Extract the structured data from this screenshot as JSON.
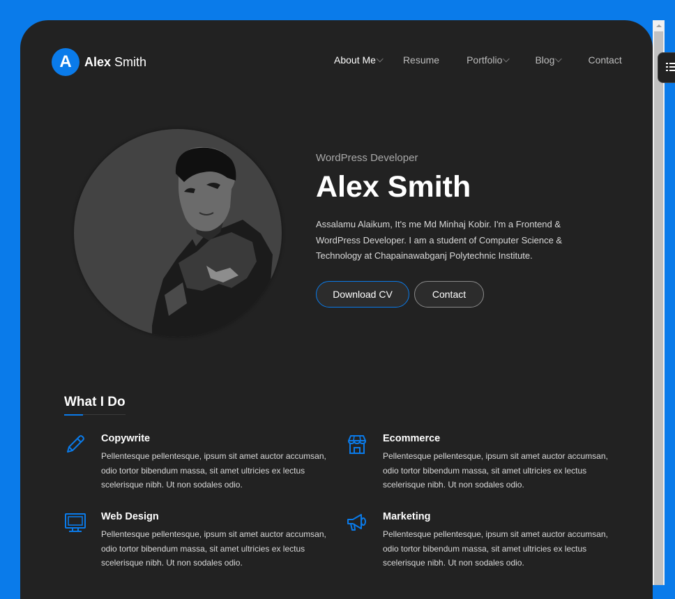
{
  "brand": {
    "badge": "A",
    "first": "Alex",
    "last": " Smith"
  },
  "nav": [
    {
      "label": "About Me",
      "dropdown": true,
      "active": true
    },
    {
      "label": "Resume",
      "dropdown": false,
      "active": false
    },
    {
      "label": "Portfolio",
      "dropdown": true,
      "active": false
    },
    {
      "label": "Blog",
      "dropdown": true,
      "active": false
    },
    {
      "label": "Contact",
      "dropdown": false,
      "active": false
    }
  ],
  "hero": {
    "subtitle": "WordPress Developer",
    "name": "Alex Smith",
    "bio": "Assalamu Alaikum, It's me Md Minhaj Kobir. I'm a Frontend & WordPress Developer. I am a student of Computer Science & Technology at Chapainawabganj Polytechnic Institute.",
    "download_cv": "Download CV",
    "contact": "Contact"
  },
  "services": {
    "title": "What I Do",
    "items": [
      {
        "title": "Copywrite",
        "icon": "pencil-icon",
        "text": "Pellentesque pellentesque, ipsum sit amet auctor accumsan, odio tortor bibendum massa, sit amet ultricies ex lectus scelerisque nibh. Ut non sodales odio."
      },
      {
        "title": "Ecommerce",
        "icon": "store-icon",
        "text": "Pellentesque pellentesque, ipsum sit amet auctor accumsan, odio tortor bibendum massa, sit amet ultricies ex lectus scelerisque nibh. Ut non sodales odio."
      },
      {
        "title": "Web Design",
        "icon": "monitor-icon",
        "text": "Pellentesque pellentesque, ipsum sit amet auctor accumsan, odio tortor bibendum massa, sit amet ultricies ex lectus scelerisque nibh. Ut non sodales odio."
      },
      {
        "title": "Marketing",
        "icon": "megaphone-icon",
        "text": "Pellentesque pellentesque, ipsum sit amet auctor accumsan, odio tortor bibendum massa, sit amet ultricies ex lectus scelerisque nibh. Ut non sodales odio."
      }
    ]
  },
  "colors": {
    "accent": "#0a7bea",
    "page_bg": "#222222",
    "outer_bg": "#0a7bea"
  }
}
